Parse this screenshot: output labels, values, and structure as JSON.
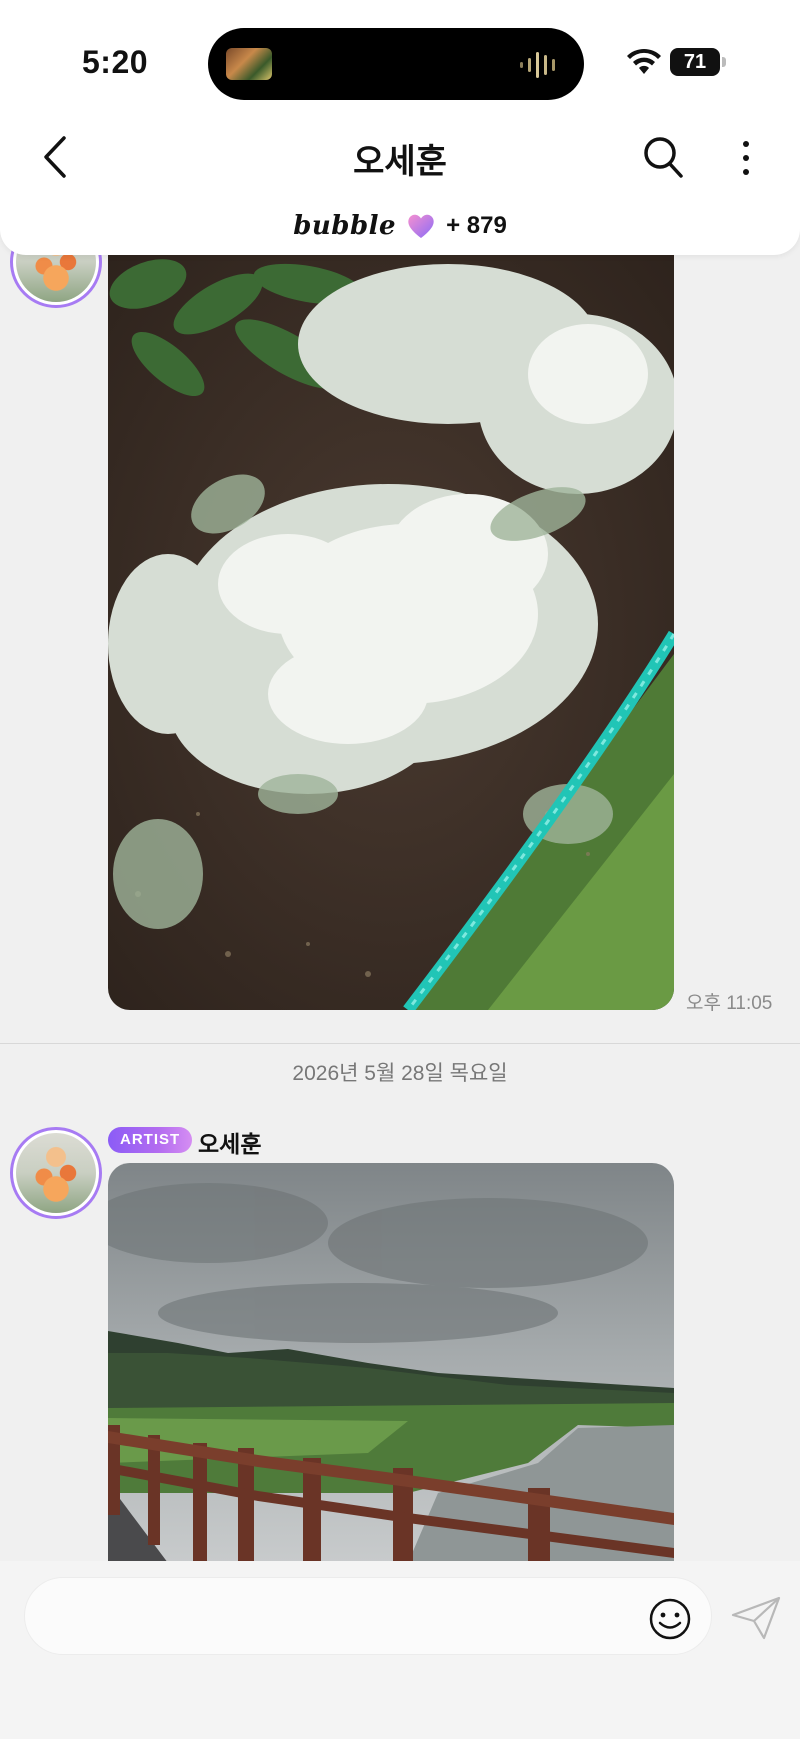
{
  "status_bar": {
    "time": "5:20",
    "battery": "71",
    "icons": [
      "wifi-icon",
      "battery-icon"
    ]
  },
  "header": {
    "title": "오세훈",
    "back_icon": "chevron-left-icon",
    "search_icon": "search-icon",
    "more_icon": "more-vertical-icon"
  },
  "subscription": {
    "logo_text": "bubble",
    "count": "+ 879",
    "heart_icon": "heart-icon"
  },
  "messages": [
    {
      "type": "image",
      "image_desc_icon": "photo-dusty-miller-plant",
      "timestamp": "오후 11:05"
    }
  ],
  "date_separator": "2026년 5월 28일 목요일",
  "messages_after": [
    {
      "badge": "ARTIST",
      "sender": "오세훈",
      "type": "image",
      "image_desc_icon": "photo-river-boardwalk"
    }
  ],
  "composer": {
    "placeholder": "",
    "emoji_icon": "smiley-icon",
    "send_icon": "paper-plane-icon"
  },
  "colors": {
    "accent_purple": "#8b5cf6",
    "background": "#f0f0f0",
    "header_bg": "#ffffff"
  }
}
